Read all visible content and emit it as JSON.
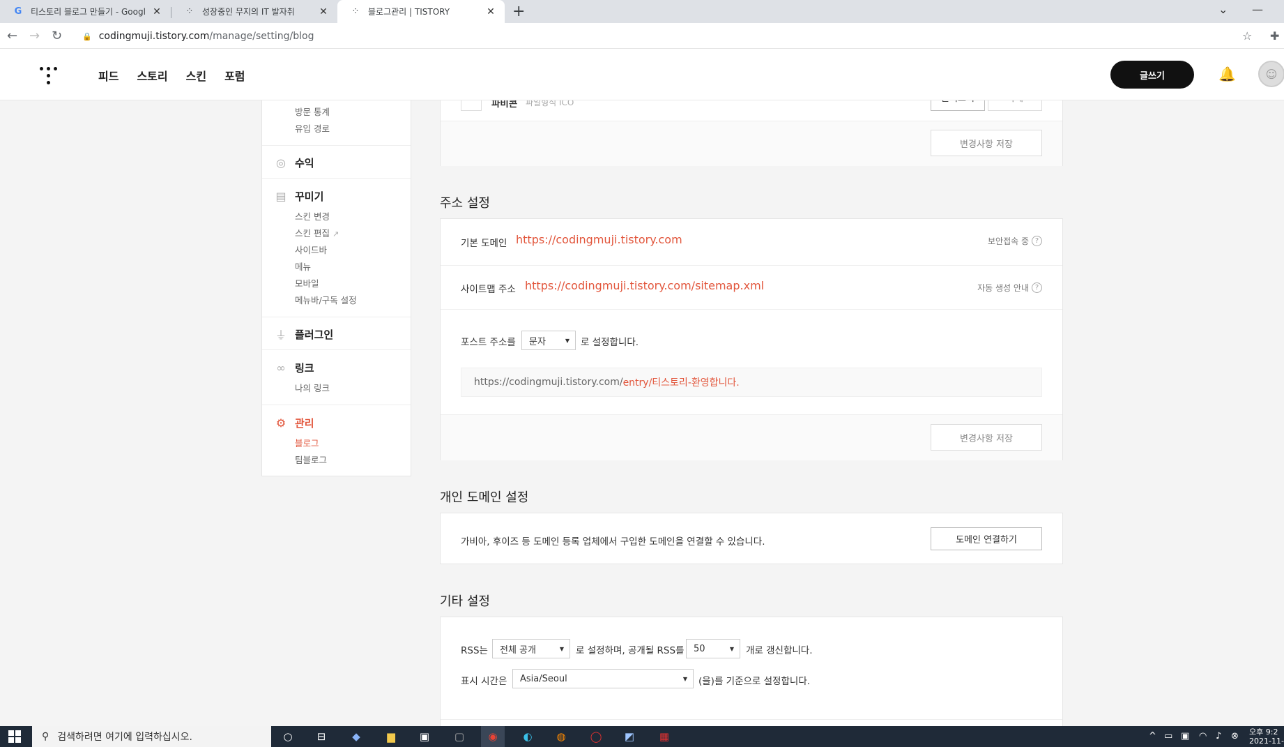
{
  "browser": {
    "tabs": [
      {
        "title": "티스토리 블로그 만들기 - Googl",
        "icon": "google-icon"
      },
      {
        "title": "성장중인 무지의 IT 발자취",
        "icon": "tistory-icon"
      },
      {
        "title": "블로그관리 | TISTORY",
        "icon": "tistory-icon"
      }
    ],
    "url_host": "codingmuji.tistory.com",
    "url_path": "/manage/setting/blog"
  },
  "header": {
    "nav": [
      "피드",
      "스토리",
      "스킨",
      "포럼"
    ],
    "write_label": "글쓰기"
  },
  "sidebar": {
    "stats_items": [
      "방문 통계",
      "유입 경로"
    ],
    "revenue": "수익",
    "decorate": "꾸미기",
    "decorate_items": [
      "스킨 변경",
      "스킨 편집",
      "사이드바",
      "메뉴",
      "모바일",
      "메뉴바/구독 설정"
    ],
    "plugin": "플러그인",
    "link": "링크",
    "link_items": [
      "나의 링크"
    ],
    "manage": "관리",
    "manage_items": [
      "블로그",
      "팀블로그"
    ]
  },
  "top_card": {
    "partial_label": "파비콘",
    "partial_value": "파일형식 ICO",
    "btn_upload": "불러오기",
    "btn_delete": "삭제",
    "save_label": "변경사항 저장"
  },
  "address": {
    "title": "주소 설정",
    "domain_label": "기본 도메인",
    "domain_url": "https://codingmuji.tistory.com",
    "domain_note": "보안접속 중",
    "sitemap_label": "사이트맵 주소",
    "sitemap_url": "https://codingmuji.tistory.com/sitemap.xml",
    "sitemap_note": "자동 생성 안내",
    "post_label": "포스트 주소를",
    "post_select": "문자",
    "post_suffix": "로 설정합니다.",
    "preview_base": "https://codingmuji.tistory.com/",
    "preview_path": "entry/티스토리-환영합니다.",
    "save_label": "변경사항 저장"
  },
  "custom_domain": {
    "title": "개인 도메인 설정",
    "desc": "가비아, 후이즈 등 도메인 등록 업체에서 구입한 도메인을 연결할 수 있습니다.",
    "connect_label": "도메인 연결하기"
  },
  "etc": {
    "title": "기타 설정",
    "rss_prefix": "RSS는",
    "rss_select": "전체 공개",
    "rss_middle": "로 설정하며, 공개될 RSS를",
    "rss_count": "50",
    "rss_suffix": "개로 갱신합니다.",
    "tz_prefix": "표시 시간은",
    "tz_select": "Asia/Seoul",
    "tz_suffix": "(을)를 기준으로 설정합니다."
  },
  "taskbar": {
    "search_placeholder": "검색하려면 여기에 입력하십시오.",
    "clock_time": "오후 9:2",
    "clock_date": "2021-11-"
  },
  "colors": {
    "accent": "#e2563c",
    "header_btn": "#111111",
    "taskbar": "#1f2a38"
  }
}
